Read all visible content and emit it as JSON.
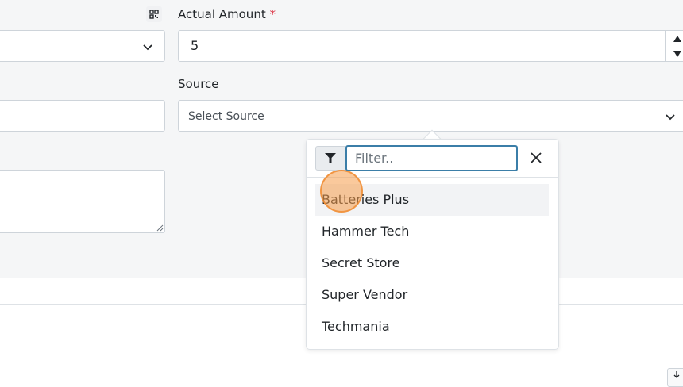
{
  "form": {
    "actual_amount": {
      "label": "Actual Amount",
      "required_mark": "*",
      "value": "5"
    },
    "source": {
      "label": "Source",
      "placeholder": "Select Source"
    }
  },
  "dropdown": {
    "filter_placeholder": "Filter..",
    "filter_value": "",
    "options": [
      "Batteries Plus",
      "Hammer Tech",
      "Secret Store",
      "Super Vendor",
      "Techmania"
    ],
    "highlighted_index": 0
  },
  "icons": {
    "scan": "qr-scan-icon",
    "chevron": "chevron-down-icon",
    "spin_up": "caret-up-icon",
    "spin_down": "caret-down-icon",
    "filter": "filter-icon",
    "clear": "close-icon",
    "download": "download-icon"
  },
  "colors": {
    "focus_border": "#3b7ea8",
    "required": "#dc3545",
    "cursor": "#f69c4b"
  }
}
